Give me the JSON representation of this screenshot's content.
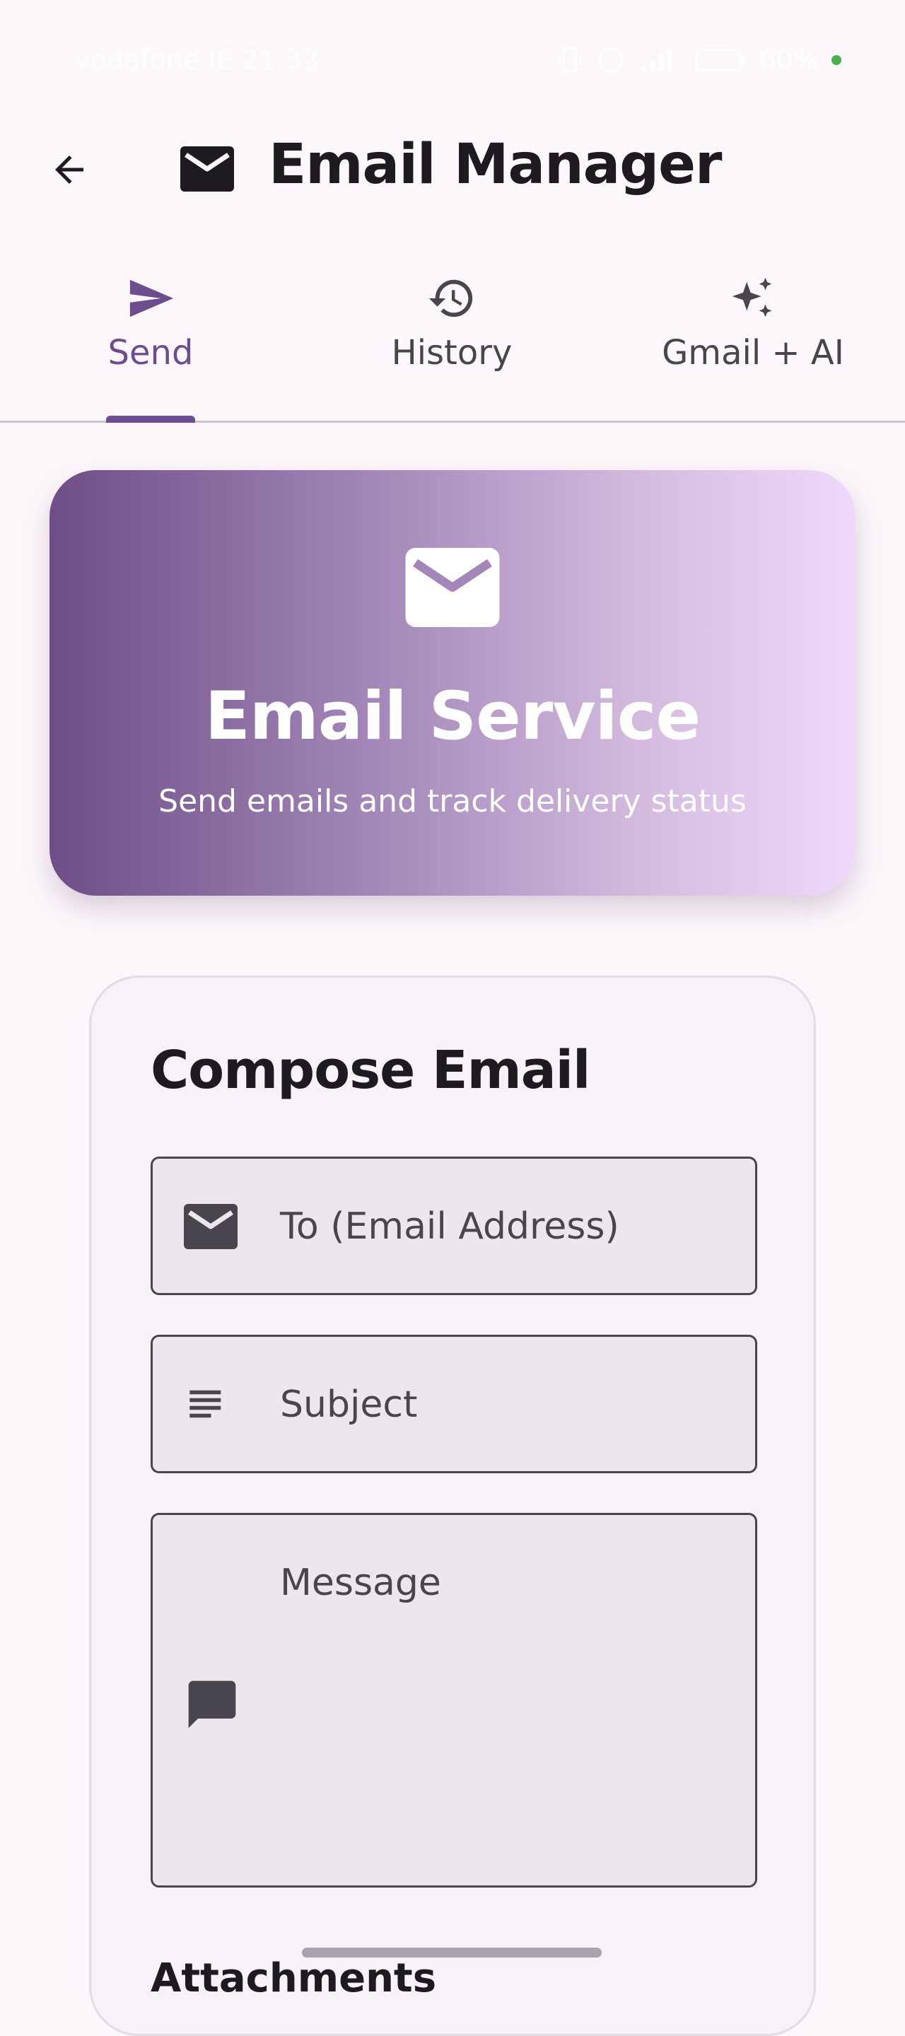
{
  "status_bar": {
    "carrier_time": "vodafone IE 21:33",
    "battery": "60%"
  },
  "app_bar": {
    "title": "Email Manager",
    "back_icon": "arrow-back-icon",
    "title_icon": "mail-icon"
  },
  "tabs": [
    {
      "label": "Send",
      "icon": "send-icon",
      "active": true
    },
    {
      "label": "History",
      "icon": "history-icon",
      "active": false
    },
    {
      "label": "Gmail + AI",
      "icon": "sparkle-icon",
      "active": false
    }
  ],
  "hero": {
    "title": "Email Service",
    "subtitle": "Send emails and track delivery status",
    "icon": "mail-icon"
  },
  "compose": {
    "title": "Compose Email",
    "to_placeholder": "To (Email Address)",
    "subject_placeholder": "Subject",
    "message_placeholder": "Message",
    "attachments_label": "Attachments"
  },
  "colors": {
    "accent": "#6d4d8e",
    "background": "#fdf7fb",
    "field_background": "#ede6ed"
  }
}
